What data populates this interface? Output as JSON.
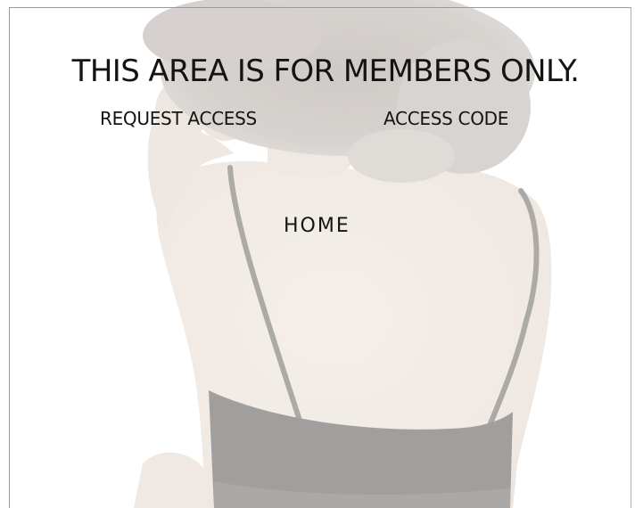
{
  "page": {
    "headline": "THIS AREA IS FOR MEMBERS ONLY.",
    "links": {
      "request_access": "REQUEST ACCESS",
      "access_code": "ACCESS CODE",
      "home": "HOME"
    }
  },
  "colors": {
    "text": "#141414",
    "background": "#ffffff",
    "photo_wash": "#f3efec",
    "bra_fabric": "#3d3d3d"
  }
}
